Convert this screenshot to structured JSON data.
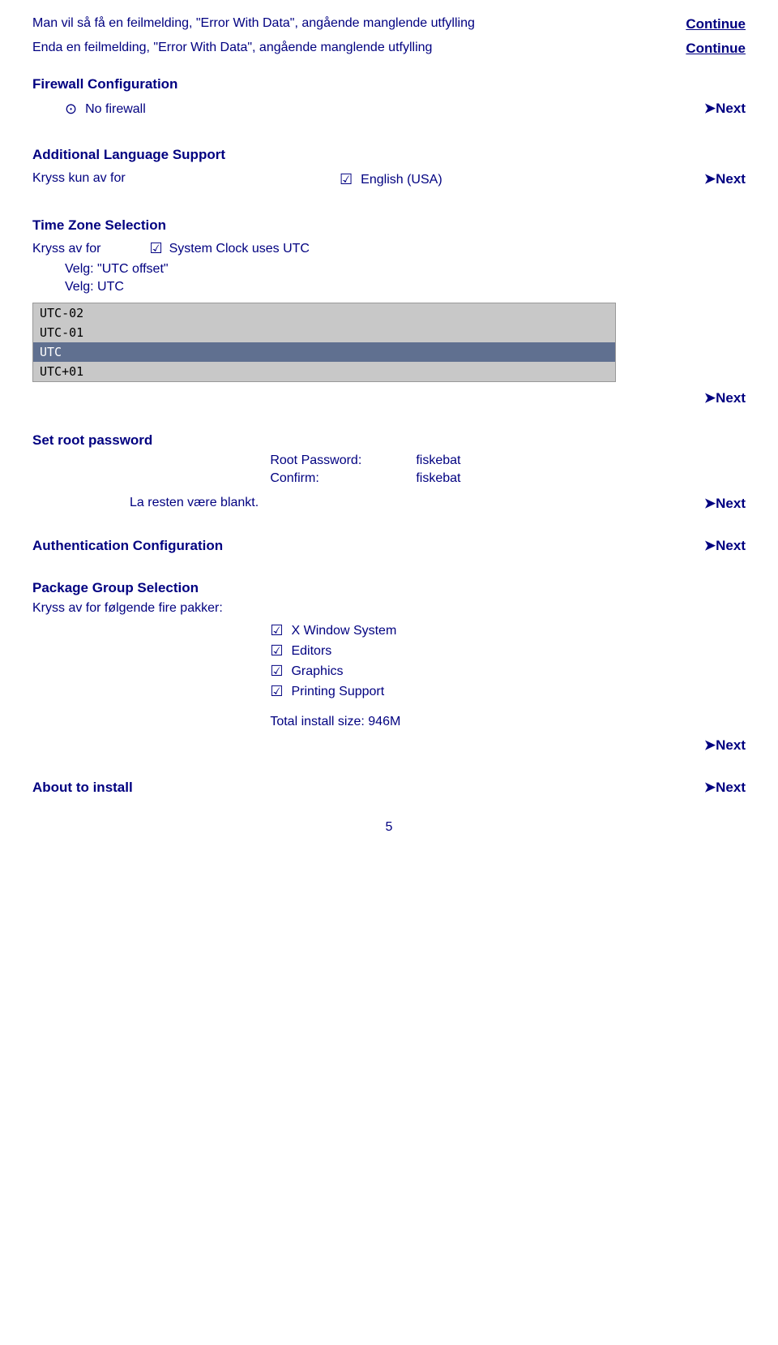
{
  "page": {
    "background": "#ffffff",
    "page_number": "5"
  },
  "sections": [
    {
      "id": "error-with-data-1",
      "left_text": "Man vil så få en feilmelding, \"Error With Data\", angående manglende utfylling",
      "right_button": "Continue"
    },
    {
      "id": "error-with-data-2",
      "left_text": "Enda en feilmelding, \"Error With Data\", angående manglende utfylling",
      "right_button": "Continue"
    },
    {
      "id": "firewall-config",
      "title": "Firewall Configuration",
      "radio_label": "No firewall",
      "right_button": "Next"
    },
    {
      "id": "language-support",
      "title": "Additional Language Support",
      "sub_label": "Kryss kun av for",
      "checkbox_label": "English (USA)",
      "right_button": "Next"
    },
    {
      "id": "timezone",
      "title": "Time Zone Selection",
      "kryss_label": "Kryss av for",
      "checkbox_label": "System Clock uses UTC",
      "velg1_label": "Velg: \"UTC offset\"",
      "velg2_label": "Velg: UTC",
      "tz_items": [
        "UTC-02",
        "UTC-01",
        "UTC",
        "UTC+01"
      ],
      "tz_selected": "UTC",
      "right_button": "Next"
    },
    {
      "id": "root-password",
      "title": "Set root password",
      "password_label": "Root Password:",
      "password_value": "fiskebat",
      "confirm_label": "Confirm:",
      "confirm_value": "fiskebat",
      "note": "La resten være blankt.",
      "right_button": "Next"
    },
    {
      "id": "auth-config",
      "title": "Authentication Configuration",
      "right_button": "Next"
    },
    {
      "id": "package-group",
      "title": "Package Group Selection",
      "sub_label": "Kryss av for følgende fire pakker:",
      "packages": [
        "X Window System",
        "Editors",
        "Graphics",
        "Printing Support"
      ],
      "total_size": "Total install size: 946M",
      "right_button": "Next"
    },
    {
      "id": "about-to-install",
      "title": "About to install",
      "right_button": "Next"
    }
  ],
  "next_label": "Next",
  "continue_label": "Continue",
  "next_arrow": "➤",
  "checked_sym": "☑",
  "radio_sym": "⊙"
}
